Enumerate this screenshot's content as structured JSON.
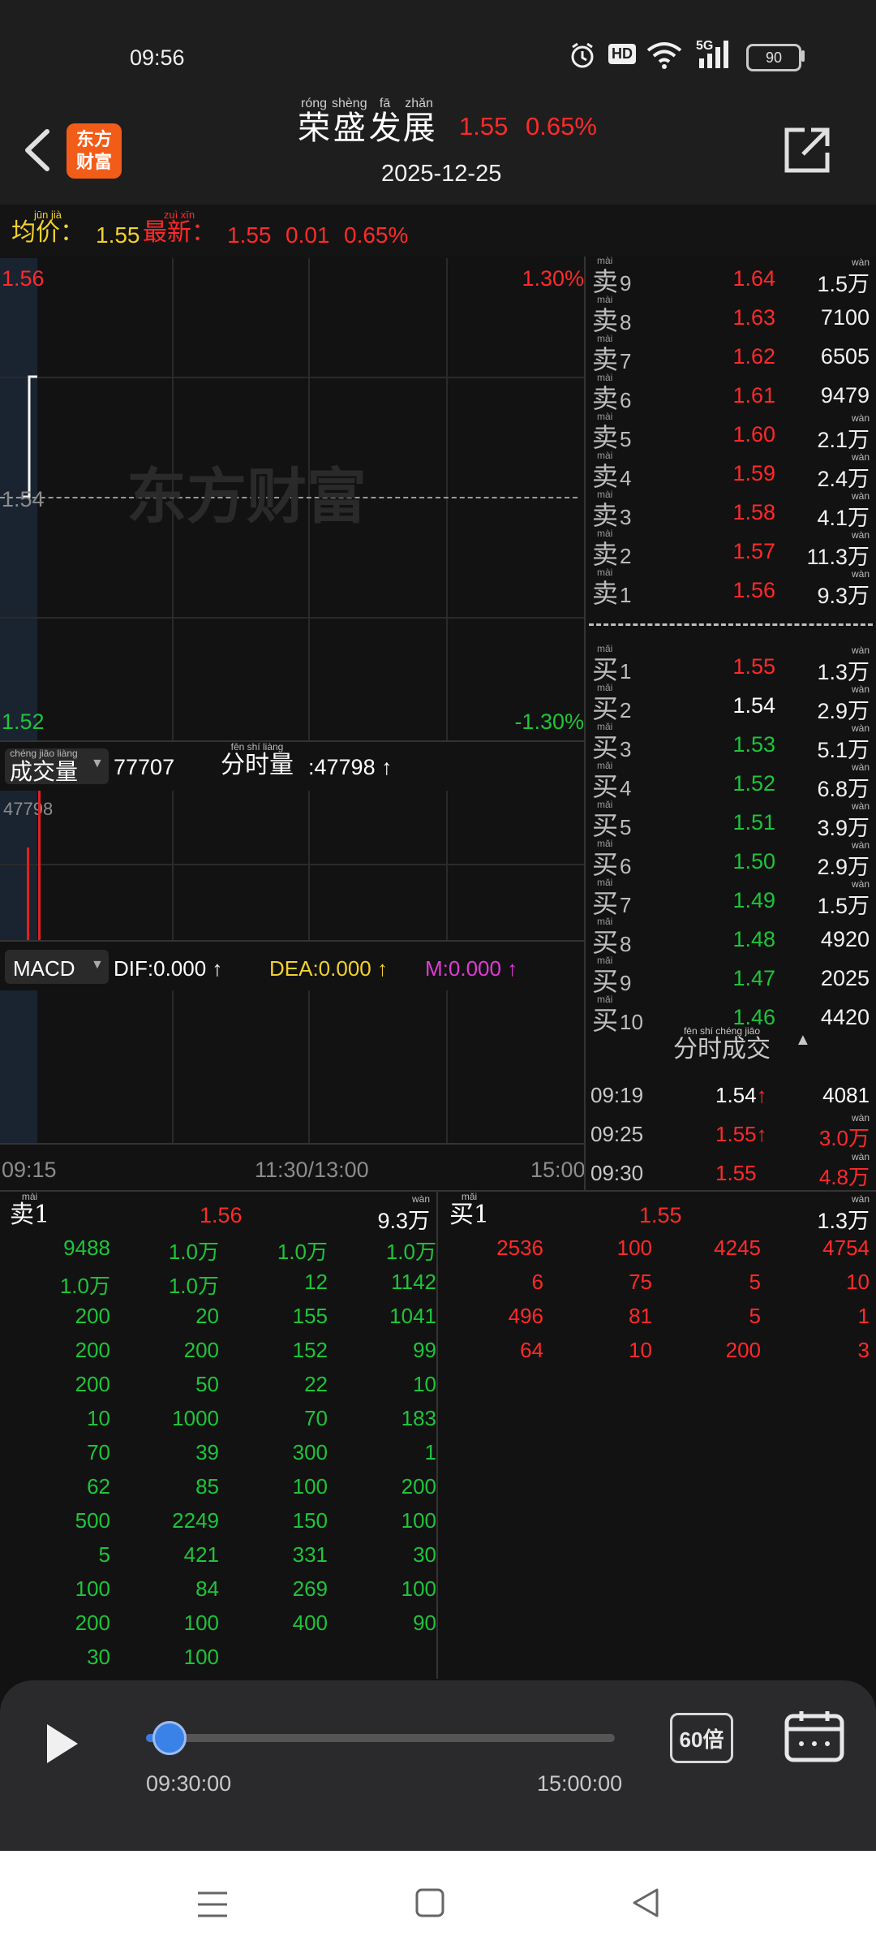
{
  "status": {
    "time": "09:56",
    "hd": "HD",
    "network": "5G",
    "battery": "90"
  },
  "header": {
    "title_chars": [
      {
        "py": "róng",
        "hz": "荣"
      },
      {
        "py": "shèng",
        "hz": "盛"
      },
      {
        "py": "fā",
        "hz": "发"
      },
      {
        "py": "zhǎn",
        "hz": "展"
      }
    ],
    "price": "1.55",
    "change_pct": "0.65%",
    "date": "2025-12-25",
    "logo_line1": "东方",
    "logo_line2": "财富"
  },
  "infobar": {
    "avg_label": {
      "py": "jūn jià",
      "hz": "均价："
    },
    "avg_value": "1.55",
    "latest_label": {
      "py": "zuì xīn",
      "hz": "最新："
    },
    "latest_price": "1.55",
    "latest_change": "0.01",
    "latest_pct": "0.65%"
  },
  "chart": {
    "y_high": "1.56",
    "y_mid": "1.54",
    "y_low": "1.52",
    "pct_high": "1.30%",
    "pct_low": "-1.30%",
    "watermark": "东方财富",
    "volume_tab": {
      "py": "chéng jiāo liàng",
      "hz": "成交量"
    },
    "volume_total": "77707",
    "intraday_label": {
      "py": "fēn shí liàng",
      "hz": "分时量"
    },
    "intraday_value": ":47798 ↑",
    "volume_axis": "47798",
    "macd_tab": "MACD",
    "dif": "DIF:0.000 ↑",
    "dea": "DEA:0.000 ↑",
    "m": "M:0.000 ↑",
    "time_start": "09:15",
    "time_mid": "11:30/13:00",
    "time_end": "15:00"
  },
  "orderbook": {
    "sell": [
      {
        "n": "9",
        "price": "1.64",
        "vol": "1.5",
        "wan": true
      },
      {
        "n": "8",
        "price": "1.63",
        "vol": "7100",
        "wan": false
      },
      {
        "n": "7",
        "price": "1.62",
        "vol": "6505",
        "wan": false
      },
      {
        "n": "6",
        "price": "1.61",
        "vol": "9479",
        "wan": false
      },
      {
        "n": "5",
        "price": "1.60",
        "vol": "2.1",
        "wan": true
      },
      {
        "n": "4",
        "price": "1.59",
        "vol": "2.4",
        "wan": true
      },
      {
        "n": "3",
        "price": "1.58",
        "vol": "4.1",
        "wan": true
      },
      {
        "n": "2",
        "price": "1.57",
        "vol": "11.3",
        "wan": true
      },
      {
        "n": "1",
        "price": "1.56",
        "vol": "9.3",
        "wan": true
      }
    ],
    "buy": [
      {
        "n": "1",
        "price": "1.55",
        "vol": "1.3",
        "wan": true,
        "c": "red"
      },
      {
        "n": "2",
        "price": "1.54",
        "vol": "2.9",
        "wan": true,
        "c": "white"
      },
      {
        "n": "3",
        "price": "1.53",
        "vol": "5.1",
        "wan": true,
        "c": "green"
      },
      {
        "n": "4",
        "price": "1.52",
        "vol": "6.8",
        "wan": true,
        "c": "green"
      },
      {
        "n": "5",
        "price": "1.51",
        "vol": "3.9",
        "wan": true,
        "c": "green"
      },
      {
        "n": "6",
        "price": "1.50",
        "vol": "2.9",
        "wan": true,
        "c": "green"
      },
      {
        "n": "7",
        "price": "1.49",
        "vol": "1.5",
        "wan": true,
        "c": "green"
      },
      {
        "n": "8",
        "price": "1.48",
        "vol": "4920",
        "wan": false,
        "c": "green"
      },
      {
        "n": "9",
        "price": "1.47",
        "vol": "2025",
        "wan": false,
        "c": "green"
      },
      {
        "n": "10",
        "price": "1.46",
        "vol": "4420",
        "wan": false,
        "c": "green"
      }
    ],
    "sell_label": {
      "py": "mài",
      "hz": "卖"
    },
    "buy_label": {
      "py": "mǎi",
      "hz": "买"
    },
    "wan": {
      "py": "wàn",
      "hz": "万"
    }
  },
  "ticks_header": {
    "py": "fēn shí chéng jiāo",
    "hz": "分时成交"
  },
  "ticks": [
    {
      "time": "09:19",
      "price": "1.54",
      "arrow": "↑",
      "vol": "4081",
      "wan": false,
      "pc": "white",
      "vc": "white"
    },
    {
      "time": "09:25",
      "price": "1.55",
      "arrow": "↑",
      "vol": "3.0",
      "wan": true,
      "pc": "red",
      "vc": "red"
    },
    {
      "time": "09:30",
      "price": "1.55",
      "arrow": "",
      "vol": "4.8",
      "wan": true,
      "pc": "red",
      "vc": "red"
    }
  ],
  "queue": {
    "sell_label": {
      "py": "mài",
      "hz": "卖1"
    },
    "sell_price": "1.56",
    "sell_vol": "9.3",
    "buy_label": {
      "py": "mǎi",
      "hz": "买1"
    },
    "buy_price": "1.55",
    "buy_vol": "1.3",
    "sell_grid": [
      [
        "9488",
        "1.0万",
        "1.0万",
        "1.0万"
      ],
      [
        "1.0万",
        "1.0万",
        "12",
        "1142"
      ],
      [
        "200",
        "20",
        "155",
        "1041"
      ],
      [
        "200",
        "200",
        "152",
        "99"
      ],
      [
        "200",
        "50",
        "22",
        "10"
      ],
      [
        "10",
        "1000",
        "70",
        "183"
      ],
      [
        "70",
        "39",
        "300",
        "1"
      ],
      [
        "62",
        "85",
        "100",
        "200"
      ],
      [
        "500",
        "2249",
        "150",
        "100"
      ],
      [
        "5",
        "421",
        "331",
        "30"
      ],
      [
        "100",
        "84",
        "269",
        "100"
      ],
      [
        "200",
        "100",
        "400",
        "90"
      ],
      [
        "30",
        "100",
        "",
        ""
      ]
    ],
    "buy_grid": [
      [
        "2536",
        "100",
        "4245",
        "4754"
      ],
      [
        "6",
        "75",
        "5",
        "10"
      ],
      [
        "496",
        "81",
        "5",
        "1"
      ],
      [
        "64",
        "10",
        "200",
        "3"
      ]
    ]
  },
  "playback": {
    "progress": 0.0,
    "start_time": "09:30:00",
    "end_time": "15:00:00",
    "speed": "60倍"
  }
}
